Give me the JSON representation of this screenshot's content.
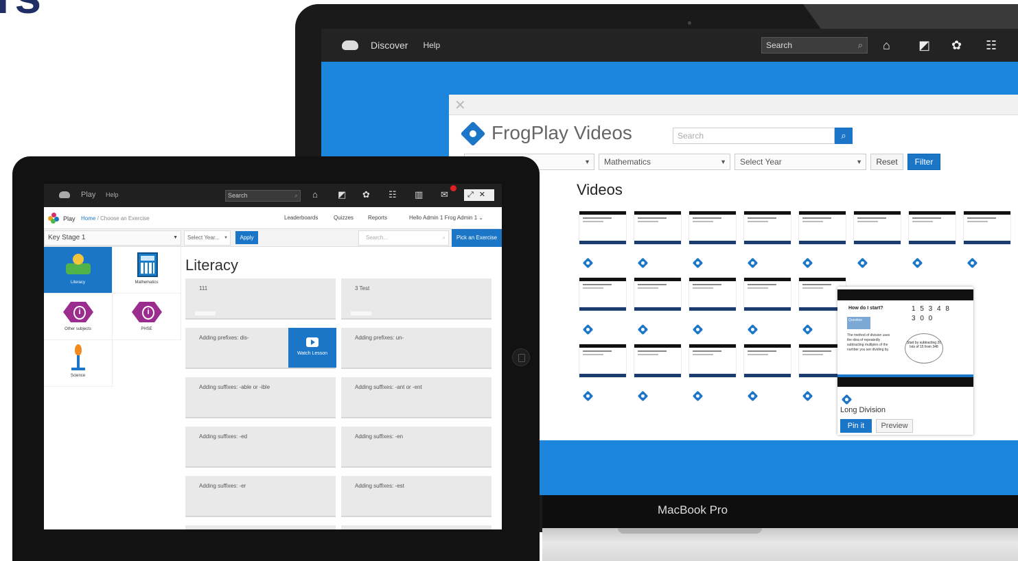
{
  "headline": "rs",
  "macbook": {
    "brand": "MacBook Pro",
    "topbar": {
      "nav": [
        "Discover",
        "Help"
      ],
      "search_placeholder": "Search",
      "icons": [
        "home-icon",
        "dashboard-icon",
        "apps-icon",
        "menu-icon"
      ]
    },
    "modal": {
      "close_symbol": "✕",
      "title": "FrogPlay Videos",
      "search_placeholder": "Search",
      "filters": {
        "subject_blank": "",
        "subject": "Mathematics",
        "year": "Select Year",
        "reset_label": "Reset",
        "filter_label": "Filter"
      },
      "section_title": "Videos",
      "popup": {
        "question": "How do I start?",
        "tag": "Question",
        "numbers_line1": "1 5 3 4 8",
        "numbers_line2": "3 0 0",
        "method_text": "The method of division uses the idea of repeatedly subtracting multiples of the number you are dividing by.",
        "bubble_text": "Start by subtracting 20 lots of 15 from 348",
        "video_title": "Long Division",
        "pin_label": "Pin it",
        "preview_label": "Preview"
      }
    }
  },
  "ipad": {
    "topbar": {
      "nav": [
        "Play",
        "Help"
      ],
      "search_placeholder": "Search"
    },
    "breadcrumb": {
      "app": "Play",
      "home": "Home",
      "separator": " / ",
      "current": "Choose an Exercise"
    },
    "topnav": [
      "Leaderboards",
      "Quizzes",
      "Reports",
      "Hello Admin 1 Frog Admin 1 ⌄"
    ],
    "filters": {
      "key_stage": "Key Stage 1",
      "year_placeholder": "Select Year...",
      "apply_label": "Apply",
      "search_placeholder": "Search...",
      "pick_label": "Pick an Exercise"
    },
    "subjects": [
      {
        "label": "Literacy"
      },
      {
        "label": "Mathematics"
      },
      {
        "label": "Other subjects"
      },
      {
        "label": "PHSE"
      },
      {
        "label": "Science"
      }
    ],
    "section_title": "Literacy",
    "exercises": [
      "111",
      "3 Test",
      "Adding prefixes: dis-",
      "Adding prefixes: un-",
      "Adding suffixes: -able or -ible",
      "Adding suffixes: -ant or -ent",
      "Adding suffixes: -ed",
      "Adding suffixes: -en",
      "Adding suffixes: -er",
      "Adding suffixes: -est"
    ],
    "watch_label": "Watch Lesson"
  }
}
